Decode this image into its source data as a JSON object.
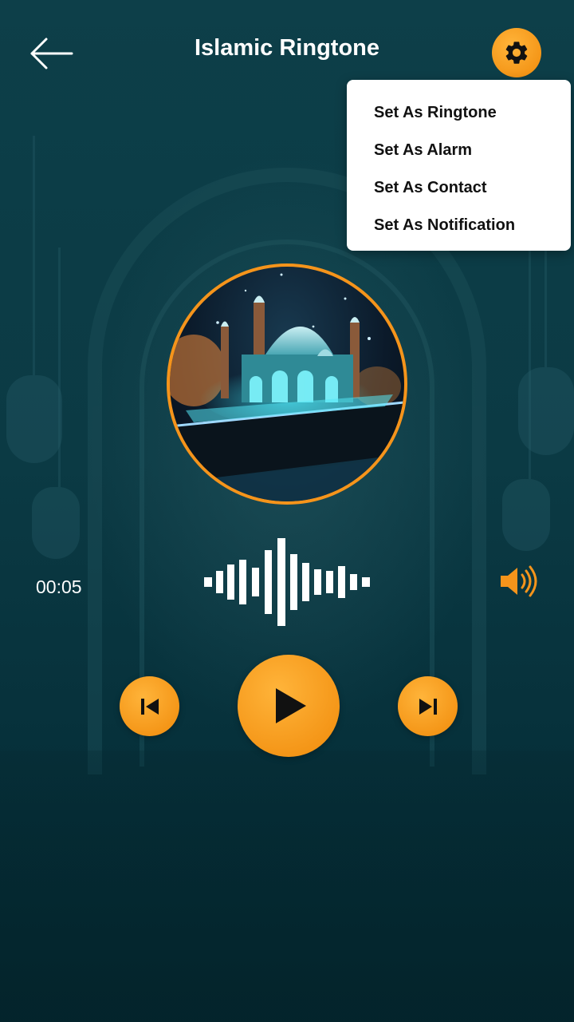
{
  "header": {
    "title": "Islamic Ringtone",
    "back_icon": "arrow-left-icon",
    "settings_icon": "gear-icon"
  },
  "menu": {
    "items": [
      {
        "label": "Set As Ringtone"
      },
      {
        "label": "Set As Alarm"
      },
      {
        "label": "Set As Contact"
      },
      {
        "label": "Set As Notification"
      }
    ]
  },
  "player": {
    "elapsed": "00:05",
    "volume_icon": "volume-icon",
    "prev_icon": "skip-previous-icon",
    "play_icon": "play-icon",
    "next_icon": "skip-next-icon",
    "artwork": "mosque-artwork"
  },
  "colors": {
    "accent": "#f5941b",
    "background": "#0c3a44",
    "menu_bg": "#ffffff",
    "text": "#ffffff"
  }
}
